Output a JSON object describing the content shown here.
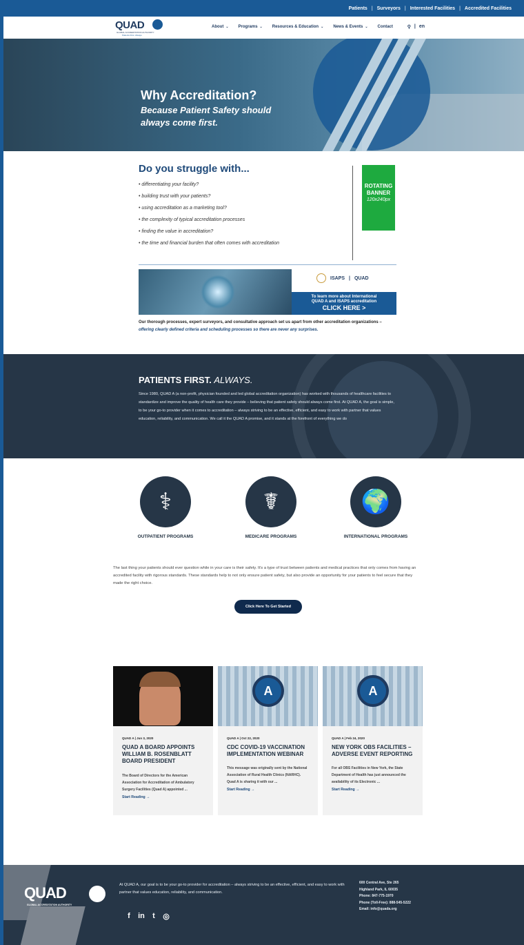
{
  "topbar": {
    "links": [
      "Patients",
      "Surveyors",
      "Interested Facilities",
      "Accredited Facilities"
    ],
    "sep": "|"
  },
  "nav": {
    "logo_word": "QUAD",
    "logo_tag1": "GLOBAL ACCREDITATION AUTHORITY",
    "logo_tag2": "Patients First. Always.",
    "items": [
      "About",
      "Programs",
      "Resources & Education",
      "News & Events",
      "Contact"
    ],
    "search_icon": "search-icon",
    "lang": "en",
    "lang_sep": "|"
  },
  "hero": {
    "title": "Why Accreditation?",
    "subtitle": "Because Patient Safety should always come first."
  },
  "struggle": {
    "title": "Do you struggle with...",
    "items": [
      "• differentiating your facility?",
      "• building trust with your patients?",
      "• using accreditation as a marketing tool?",
      "• the complexity of typical accreditation processes",
      "• finding the value in accreditation?",
      "• the time and financial burden that often comes with accreditation"
    ]
  },
  "banner": {
    "line1": "ROTATING",
    "line2": "BANNER",
    "size": "120x240px"
  },
  "isaps": {
    "logo_isaps": "ISAPS",
    "logo_quad": "QUAD",
    "line1": "To learn more about International",
    "line2": "QUAD A and ISAPS accreditation",
    "cta": "CLICK HERE >"
  },
  "intro": {
    "bold": "Our thorough processes, expert surveyors, and consultative approach set us apart from other accreditation organizations –",
    "italic": "offering clearly defined criteria and scheduling processes so there are never any surprises."
  },
  "patients_first": {
    "title": "PATIENTS FIRST.",
    "title_italic": "ALWAYS.",
    "body": "Since 1980, QUAD A (a non-profit, physician founded and led global accreditation organization) has worked with thousands of healthcare facilities to standardize and improve the quality of health care they provide – believing that patient safety should always come first. At QUAD A, the goal is simple, to be your go-to provider when it comes to accreditation – always striving to be an effective, efficient, and easy to work with partner that values education, reliability, and communication. We call it the QUAD A promise, and it stands at the forefront of everything we do"
  },
  "programs": [
    {
      "label": "OUTPATIENT PROGRAMS",
      "icon": "stethoscope-icon",
      "glyph": "⚕"
    },
    {
      "label": "MEDICARE PROGRAMS",
      "icon": "caduceus-icon",
      "glyph": "☤"
    },
    {
      "label": "INTERNATIONAL PROGRAMS",
      "icon": "globe-icon",
      "glyph": "🌍"
    }
  ],
  "body_text": "The last thing your patients should ever question while in your care is their safety. It's a type of trust between patients and medical practices that only comes from having an accredited facility with rigorous standards. These standards help to not only ensure patient safety, but also provide an opportunity for your patients to feel secure that they made the right choice.",
  "cta": "Click Here To Get Started",
  "news": [
    {
      "meta": "QUAD A  |  Jun 3, 2020",
      "title": "QUAD A BOARD APPOINTS WILLIAM B. ROSENBLATT BOARD PRESIDENT",
      "excerpt": "The Board of Directors for the American Association for Accreditation of Ambulatory Surgery Facilities (Quad A) appointed ...",
      "more": "Start Reading  →"
    },
    {
      "meta": "QUAD A  |  Oct 22, 2020",
      "title": "CDC COVID-19 VACCINATION IMPLEMENTATION WEBINAR",
      "excerpt": "This message was originally sent by the National Association of Rural Health Clinics (NARHC). Quad A is sharing it with our ...",
      "more": "Start Reading  →"
    },
    {
      "meta": "QUAD A  |  Feb 24, 2020",
      "title": "NEW YORK OBS FACILITIES – ADVERSE EVENT REPORTING",
      "excerpt": "For all OBS Facilities in New York, the State Department of Health has just announced the availability of its Electronic ...",
      "more": "Start Reading  →"
    }
  ],
  "footer": {
    "logo": "QUAD",
    "tag": "GLOBAL ACCREDITATION AUTHORITY",
    "text": "At QUAD A, our goal is to be your go-to provider for accreditation – always striving to be an effective, efficient, and easy to work with partner that values education, reliability, and communication.",
    "address": [
      "600 Central Ave, Ste 265",
      "Highland Park, IL 60035",
      "Phone: 847-775-1970",
      "Phone (Toll-Free): 888-545-5222",
      "Email: info@quada.org"
    ],
    "social": [
      {
        "name": "facebook-icon",
        "glyph": "f"
      },
      {
        "name": "linkedin-icon",
        "glyph": "in"
      },
      {
        "name": "twitter-icon",
        "glyph": "t"
      },
      {
        "name": "instagram-icon",
        "glyph": "◎"
      }
    ]
  }
}
